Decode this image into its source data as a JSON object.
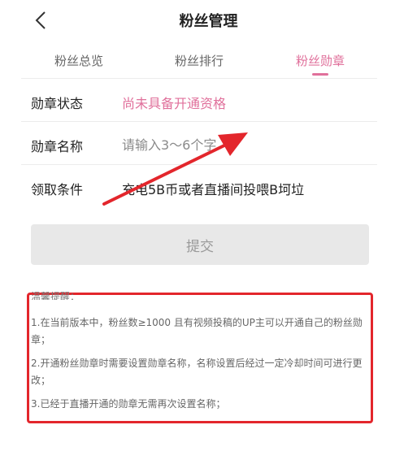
{
  "header": {
    "title": "粉丝管理",
    "back_icon": "chevron-left-icon"
  },
  "tabs": [
    {
      "label": "粉丝总览",
      "active": false
    },
    {
      "label": "粉丝排行",
      "active": false
    },
    {
      "label": "粉丝勋章",
      "active": true
    }
  ],
  "form": {
    "status_label": "勋章状态",
    "status_value": "尚未具备开通资格",
    "name_label": "勋章名称",
    "name_placeholder": "请输入3～6个字",
    "condition_label": "领取条件",
    "condition_value": "充电5B币或者直播间投喂B坷垃"
  },
  "submit_label": "提交",
  "notice": {
    "title": "温馨提醒：",
    "items": [
      "1.在当前版本中，粉丝数≥1000 且有视频投稿的UP主可以开通自己的粉丝勋章；",
      "2.开通粉丝勋章时需要设置勋章名称，名称设置后经过一定冷却时间可进行更改；",
      "3.已经于直播开通的勋章无需再次设置名称；"
    ]
  },
  "colors": {
    "accent": "#e0709b",
    "annotation": "#e3262c"
  }
}
